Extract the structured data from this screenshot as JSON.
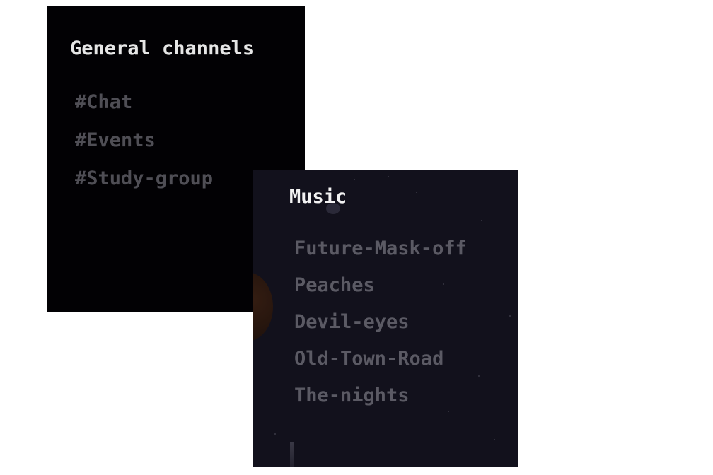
{
  "general_panel": {
    "title": "General channels",
    "channels": [
      "#Chat",
      "#Events",
      "#Study-group"
    ]
  },
  "music_panel": {
    "title": "Music",
    "channels": [
      "Future-Mask-off",
      "Peaches",
      "Devil-eyes",
      "Old-Town-Road",
      "The-nights"
    ]
  },
  "colors": {
    "page_background": "#ffffff",
    "general_panel_background": "#020104",
    "music_panel_background": "#12111c",
    "title_text": "#e6e6e6",
    "channel_text": "#4f4e55"
  }
}
